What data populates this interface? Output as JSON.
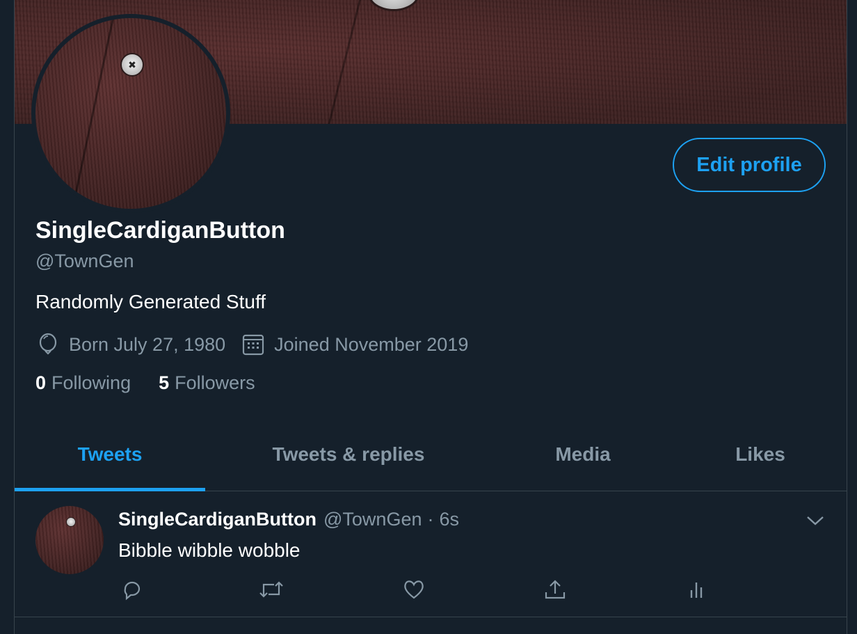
{
  "profile": {
    "display_name": "SingleCardiganButton",
    "handle": "@TownGen",
    "bio": "Randomly Generated Stuff",
    "born": "Born July 27, 1980",
    "joined": "Joined November 2019",
    "following_count": "0",
    "following_label": "Following",
    "followers_count": "5",
    "followers_label": "Followers",
    "edit_profile_label": "Edit profile"
  },
  "tabs": [
    {
      "label": "Tweets",
      "active": true
    },
    {
      "label": "Tweets & replies",
      "active": false
    },
    {
      "label": "Media",
      "active": false
    },
    {
      "label": "Likes",
      "active": false
    }
  ],
  "tweet": {
    "name": "SingleCardiganButton",
    "handle": "@TownGen",
    "separator": "·",
    "time": "6s",
    "text": "Bibble wibble wobble"
  },
  "icons": {
    "born": "balloon-icon",
    "joined": "calendar-icon",
    "caret": "chevron-down-icon",
    "reply": "reply-icon",
    "retweet": "retweet-icon",
    "like": "heart-icon",
    "share": "share-icon",
    "analytics": "analytics-icon"
  },
  "colors": {
    "background": "#15202b",
    "accent": "#1da1f2",
    "secondary_text": "#8899a6",
    "border": "#38444d"
  }
}
